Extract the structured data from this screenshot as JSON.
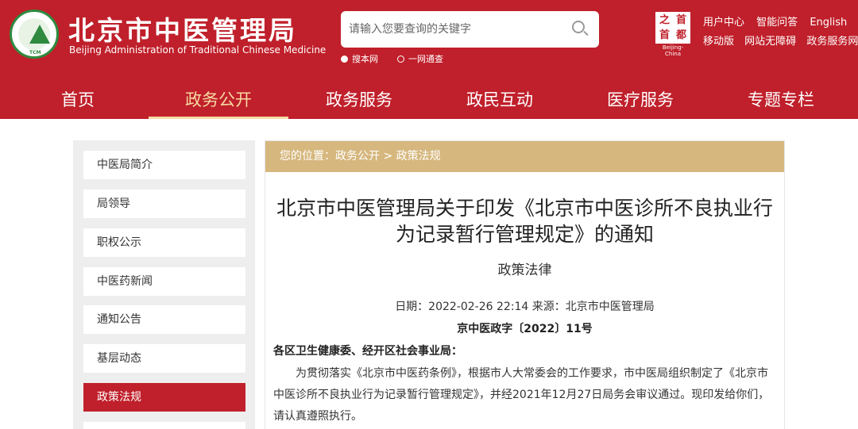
{
  "header": {
    "site_title": "北京市中医管理局",
    "site_subtitle": "Beijing Administration of Traditional Chinese Medicine",
    "logo_text": "TCM",
    "search": {
      "placeholder": "请输入您要查询的关键字"
    },
    "search_scope": [
      {
        "label": "搜本网",
        "selected": true
      },
      {
        "label": "一网通查",
        "selected": false
      }
    ],
    "capital_logo": {
      "chars": [
        "之",
        "首",
        "首",
        "都"
      ],
      "caption": "Beijing-China"
    },
    "top_links": [
      "用户中心",
      "智能问答",
      "English"
    ],
    "top_links2": [
      "移动版",
      "网站无障碍",
      "政务服务网"
    ]
  },
  "nav": {
    "items": [
      "首页",
      "政务公开",
      "政务服务",
      "政民互动",
      "医疗服务",
      "专题专栏"
    ],
    "active": "政务公开"
  },
  "sidebar": {
    "items": [
      "中医局简介",
      "局领导",
      "职权公示",
      "中医药新闻",
      "通知公告",
      "基层动态",
      "政策法规"
    ],
    "active": "政策法规"
  },
  "breadcrumb": "您的位置：政务公开 > 政策法规",
  "article": {
    "title": "北京市中医管理局关于印发《北京市中医诊所不良执业行为记录暂行管理规定》的通知",
    "category": "政策法律",
    "meta": "日期：2022-02-26 22:14  来源：北京市中医管理局",
    "doc_no": "京中医政字〔2022〕11号",
    "addressee": "各区卫生健康委、经开区社会事业局：",
    "body": "为贯彻落实《北京市中医药条例》，根据市人大常委会的工作要求，市中医局组织制定了《北京市中医诊所不良执业行为记录暂行管理规定》，并经2021年12月27日局务会审议通过。现印发给你们，请认真遵照执行。"
  },
  "colors": {
    "brand_red": "#c0202b",
    "nav_active": "#f6d9a3",
    "breadcrumb_bg": "#d6b77e"
  }
}
